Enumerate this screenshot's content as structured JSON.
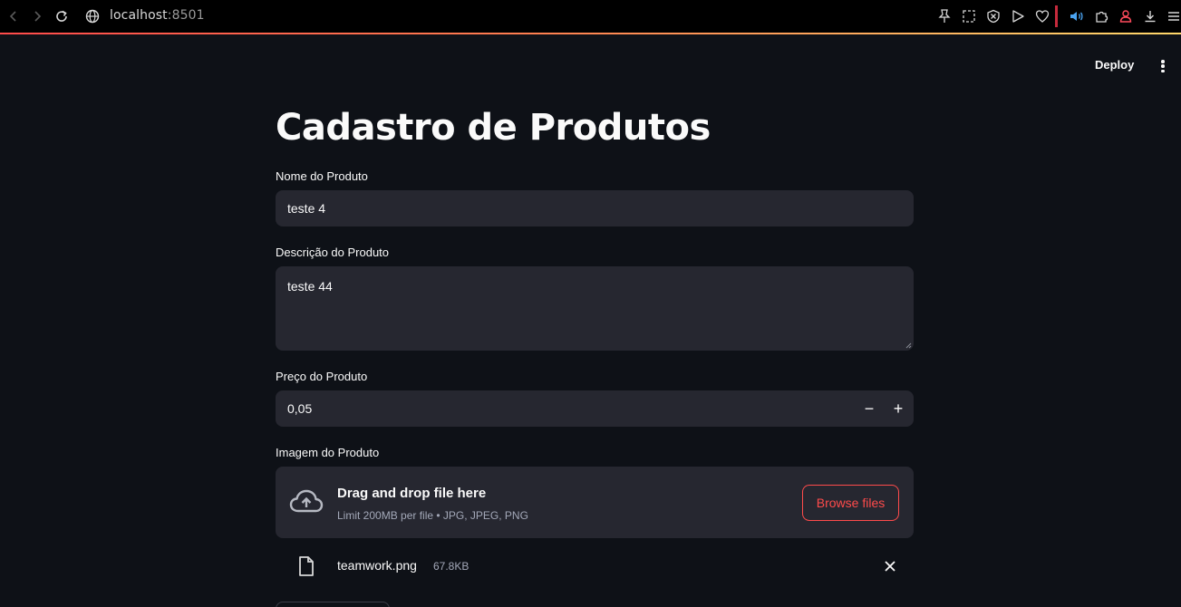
{
  "browser": {
    "url_host": "localhost",
    "url_port": ":8501"
  },
  "header": {
    "deploy_label": "Deploy"
  },
  "page": {
    "title": "Cadastro de Produtos"
  },
  "form": {
    "name": {
      "label": "Nome do Produto",
      "value": "teste 4"
    },
    "description": {
      "label": "Descrição do Produto",
      "value": "teste 44"
    },
    "price": {
      "label": "Preço do Produto",
      "value": "0,05",
      "minus": "−",
      "plus": "+"
    },
    "image": {
      "label": "Imagem do Produto",
      "drag_text": "Drag and drop file here",
      "limit_text": "Limit 200MB per file • JPG, JPEG, PNG",
      "browse_label": "Browse files",
      "file_name": "teamwork.png",
      "file_size": "67.8KB"
    }
  },
  "colors": {
    "background": "#0e1117",
    "input_bg": "#262730",
    "accent": "#ff4b4b",
    "muted_text": "#a3a8b8"
  }
}
